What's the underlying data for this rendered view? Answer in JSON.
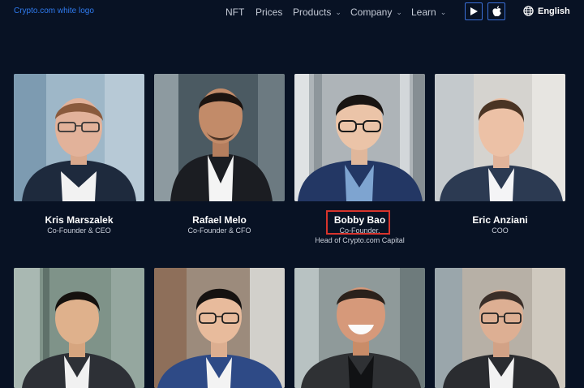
{
  "header": {
    "logo_text": "Crypto.com white logo",
    "nav": [
      {
        "label": "NFT",
        "dropdown": false
      },
      {
        "label": "Prices",
        "dropdown": false
      },
      {
        "label": "Products",
        "dropdown": true
      },
      {
        "label": "Company",
        "dropdown": true
      },
      {
        "label": "Learn",
        "dropdown": true
      }
    ],
    "stores": [
      {
        "icon": "play-store-icon"
      },
      {
        "icon": "apple-icon"
      }
    ],
    "language": {
      "icon": "globe-icon",
      "label": "English"
    },
    "accent_color": "#2f7bf0"
  },
  "team": [
    {
      "name": "Kris Marszalek",
      "role_lines": [
        "Co-Founder & CEO"
      ]
    },
    {
      "name": "Rafael Melo",
      "role_lines": [
        "Co-Founder & CFO"
      ]
    },
    {
      "name": "Bobby Bao",
      "role_lines": [
        "Co-Founder,",
        "Head of Crypto.com Capital"
      ],
      "highlighted": true
    },
    {
      "name": "Eric Anziani",
      "role_lines": [
        "COO"
      ]
    },
    {
      "name": "",
      "role_lines": []
    },
    {
      "name": "",
      "role_lines": []
    },
    {
      "name": "",
      "role_lines": []
    },
    {
      "name": "",
      "role_lines": []
    }
  ],
  "colors": {
    "background": "#081224",
    "highlight_border": "#d8342c"
  }
}
